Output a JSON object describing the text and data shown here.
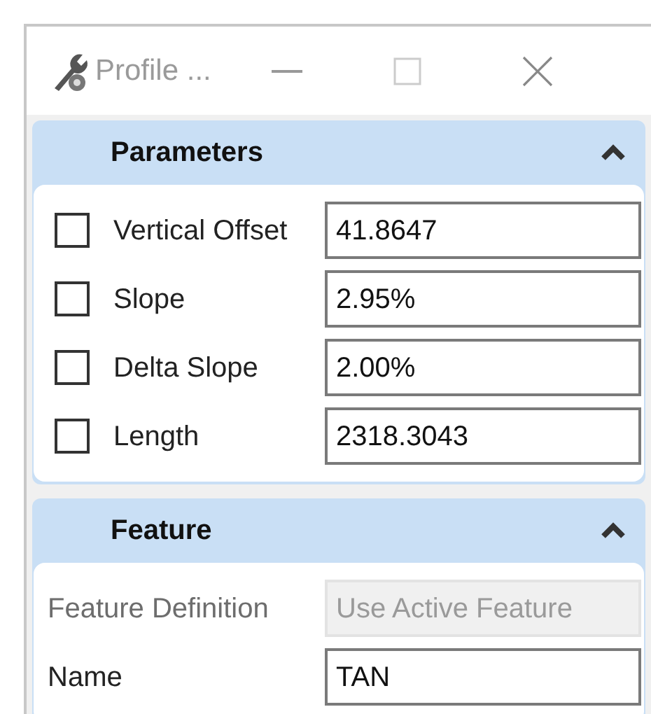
{
  "window": {
    "title": "Profile ..."
  },
  "sections": [
    {
      "title": "Parameters",
      "expanded": true,
      "kind": "checkbox_rows",
      "rows": [
        {
          "label": "Vertical Offset",
          "checked": false,
          "value": "41.8647"
        },
        {
          "label": "Slope",
          "checked": false,
          "value": "2.95%"
        },
        {
          "label": "Delta Slope",
          "checked": false,
          "value": "2.00%"
        },
        {
          "label": "Length",
          "checked": false,
          "value": "2318.3043"
        }
      ]
    },
    {
      "title": "Feature",
      "expanded": true,
      "kind": "plain_rows",
      "rows": [
        {
          "label": "Feature Definition",
          "disabled": true,
          "value": "Use Active Feature"
        },
        {
          "label": "Name",
          "disabled": false,
          "value": "TAN"
        }
      ]
    }
  ]
}
